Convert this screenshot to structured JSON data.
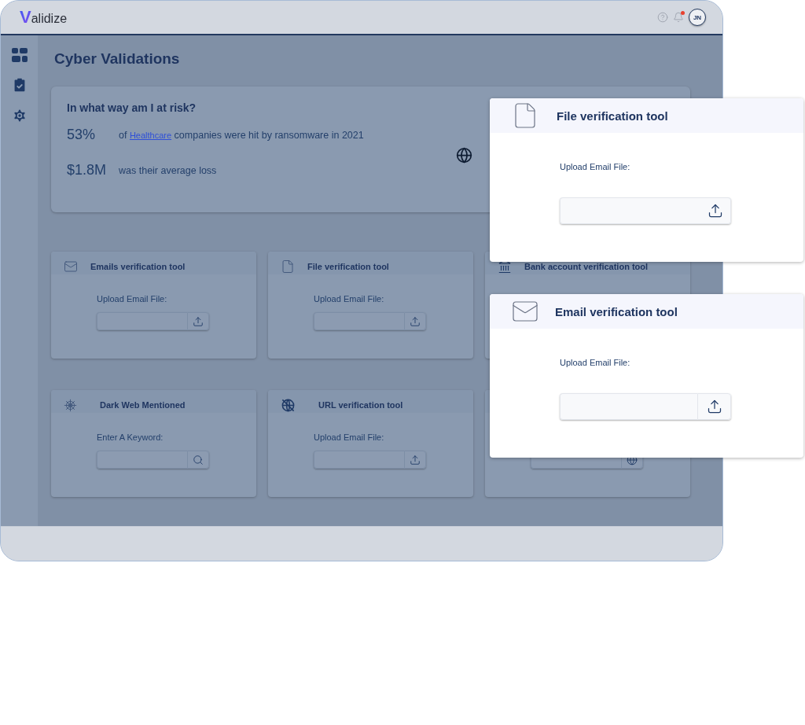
{
  "header": {
    "logo": {
      "mark": "V",
      "text": "alidize"
    },
    "notifications_unread": true,
    "avatar": "JN"
  },
  "sidebar": {
    "items": [
      {
        "kind": "dashboard"
      },
      {
        "kind": "tasks"
      },
      {
        "kind": "settings"
      }
    ]
  },
  "page": {
    "title": "Cyber Validations",
    "risk": {
      "heading": "In what way am I at risk?",
      "stats": [
        {
          "value": "53%",
          "prefix": "of",
          "link": "Healthcare",
          "suffix": "companies were hit by ransomware in 2021"
        },
        {
          "value": "$1.8M",
          "text": "was their average loss"
        }
      ]
    },
    "tools": [
      {
        "kind": "mail",
        "title": "Emails verification tool",
        "label": "Upload Email File:",
        "button": {
          "kind": "upload"
        }
      },
      {
        "kind": "file",
        "title": "File verification tool",
        "label": "Upload Email File:",
        "button": {
          "kind": "upload"
        }
      },
      {
        "kind": "bank",
        "title": "Bank account verification tool"
      },
      {
        "kind": "web",
        "title": "Dark Web Mentioned",
        "label": "Enter A Keyword:",
        "button": {
          "kind": "search"
        }
      },
      {
        "kind": "globe-off",
        "title": "URL verification tool",
        "label": "Upload Email File:",
        "button": {
          "kind": "upload"
        }
      },
      {
        "kind": "hidden",
        "button": {
          "kind": "globe"
        }
      }
    ]
  },
  "popups": [
    {
      "kind": "file",
      "title": "File verification tool",
      "label": "Upload Email File:",
      "button": {
        "kind": "upload"
      },
      "split": false
    },
    {
      "kind": "mail",
      "title": "Email verification tool",
      "label": "Upload Email File:",
      "button": {
        "kind": "upload"
      },
      "split": true
    }
  ]
}
